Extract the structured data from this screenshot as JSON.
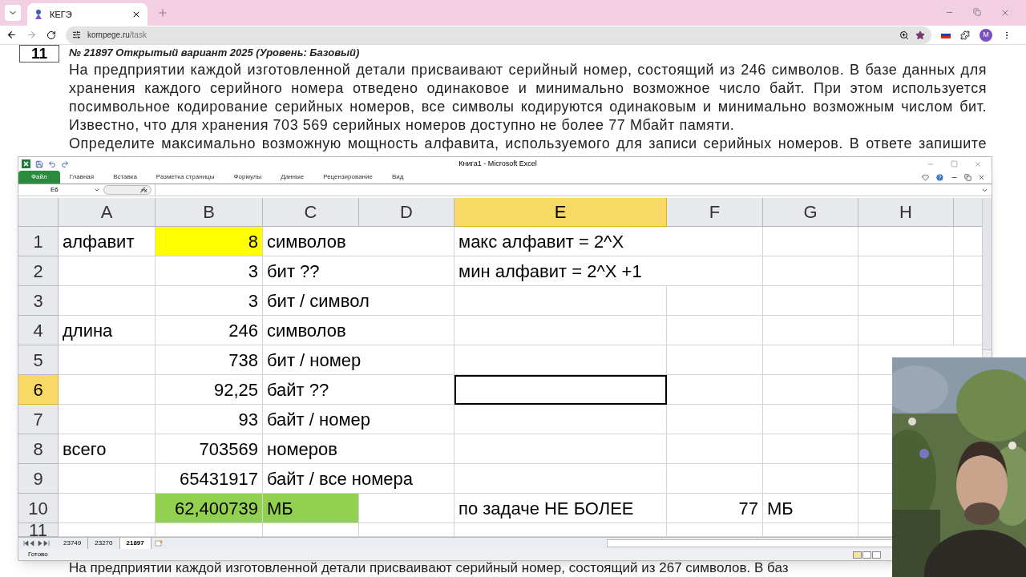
{
  "browser": {
    "tab_title": "КЕГЭ",
    "url_host": "kompege.ru",
    "url_path": "/task",
    "avatar": "M"
  },
  "task": {
    "number": "11",
    "title": "№ 21897 Открытый вариант 2025 (Уровень: Базовый)",
    "paragraphs": [
      "На предприятии каждой изготовленной детали присваивают серийный номер, состоящий из 246 символов. В базе данных для хранения каждого серийного номера отведено одинаковое и минимально возможное число байт. При этом используется посимвольное кодирование серийных номеров, все символы кодируются одинаковым и минимально возможным числом бит. Известно, что для хранения 703 569 серийных номеров доступно не более 77 Мбайт памяти.",
      "Определите максимально возможную мощность алфавита, используемого для записи серийных номеров. В ответе запишите"
    ],
    "next_text": "На предприятии каждой изготовленной детали присваивают серийный номер, состоящий из 267 символов. В баз"
  },
  "excel": {
    "title": "Книга1 - Microsoft Excel",
    "file_menu": "Файл",
    "ribbon_tabs": [
      "Главная",
      "Вставка",
      "Разметка страницы",
      "Формулы",
      "Данные",
      "Рецензирование",
      "Вид"
    ],
    "name_box": "E6",
    "columns": [
      {
        "label": "A",
        "selected": false
      },
      {
        "label": "B",
        "selected": false
      },
      {
        "label": "C",
        "selected": false
      },
      {
        "label": "D",
        "selected": false
      },
      {
        "label": "E",
        "selected": true
      },
      {
        "label": "F",
        "selected": false
      },
      {
        "label": "G",
        "selected": false
      },
      {
        "label": "H",
        "selected": false
      }
    ],
    "rows": [
      {
        "header": "1",
        "selected": false,
        "cells": [
          {
            "text": "алфавит",
            "kind": "text",
            "selected": false
          },
          {
            "text": "8",
            "kind": "number",
            "color": "#ffff00",
            "selected": false
          },
          {
            "text": "символов",
            "kind": "text",
            "selected": false
          },
          {
            "selected": false
          },
          {
            "text": "макс алфавит = 2^X",
            "kind": "text",
            "selected": false
          },
          {
            "selected": false
          },
          {
            "selected": false
          },
          {
            "selected": false
          }
        ]
      },
      {
        "header": "2",
        "selected": false,
        "cells": [
          {
            "selected": false
          },
          {
            "text": "3",
            "kind": "number",
            "selected": false
          },
          {
            "text": "бит ??",
            "kind": "text",
            "selected": false
          },
          {
            "selected": false
          },
          {
            "text": "мин алфавит = 2^X +1",
            "kind": "text",
            "selected": false
          },
          {
            "selected": false
          },
          {
            "selected": false
          },
          {
            "selected": false
          }
        ]
      },
      {
        "header": "3",
        "selected": false,
        "cells": [
          {
            "selected": false
          },
          {
            "text": "3",
            "kind": "number",
            "selected": false
          },
          {
            "text": "бит / символ",
            "kind": "text",
            "selected": false
          },
          {
            "selected": false
          },
          {
            "selected": false
          },
          {
            "selected": false
          },
          {
            "selected": false
          },
          {
            "selected": false
          }
        ]
      },
      {
        "header": "4",
        "selected": false,
        "cells": [
          {
            "text": "длина",
            "kind": "text",
            "selected": false
          },
          {
            "text": "246",
            "kind": "number",
            "selected": false
          },
          {
            "text": "символов",
            "kind": "text",
            "selected": false
          },
          {
            "selected": false
          },
          {
            "selected": false
          },
          {
            "selected": false
          },
          {
            "selected": false
          },
          {
            "selected": false
          }
        ]
      },
      {
        "header": "5",
        "selected": false,
        "cells": [
          {
            "selected": false
          },
          {
            "text": "738",
            "kind": "number",
            "selected": false
          },
          {
            "text": "бит / номер",
            "kind": "text",
            "selected": false
          },
          {
            "selected": false
          },
          {
            "selected": false
          },
          {
            "selected": false
          },
          {
            "selected": false
          },
          {
            "selected": false
          }
        ]
      },
      {
        "header": "6",
        "selected": true,
        "cells": [
          {
            "selected": false
          },
          {
            "text": "92,25",
            "kind": "number",
            "selected": false
          },
          {
            "text": "байт ??",
            "kind": "text",
            "selected": false
          },
          {
            "selected": false
          },
          {
            "selected": true
          },
          {
            "selected": false
          },
          {
            "selected": false
          },
          {
            "selected": false
          }
        ]
      },
      {
        "header": "7",
        "selected": false,
        "cells": [
          {
            "selected": false
          },
          {
            "text": "93",
            "kind": "number",
            "selected": false
          },
          {
            "text": "байт / номер",
            "kind": "text",
            "selected": false
          },
          {
            "selected": false
          },
          {
            "selected": false
          },
          {
            "selected": false
          },
          {
            "selected": false
          },
          {
            "selected": false
          }
        ]
      },
      {
        "header": "8",
        "selected": false,
        "cells": [
          {
            "text": "всего",
            "kind": "text",
            "selected": false
          },
          {
            "text": "703569",
            "kind": "number",
            "selected": false
          },
          {
            "text": "номеров",
            "kind": "text",
            "selected": false
          },
          {
            "selected": false
          },
          {
            "selected": false
          },
          {
            "selected": false
          },
          {
            "selected": false
          },
          {
            "selected": false
          }
        ]
      },
      {
        "header": "9",
        "selected": false,
        "cells": [
          {
            "selected": false
          },
          {
            "text": "65431917",
            "kind": "number",
            "selected": false
          },
          {
            "text": "байт / все номера",
            "kind": "text",
            "selected": false
          },
          {
            "selected": false
          },
          {
            "selected": false
          },
          {
            "selected": false
          },
          {
            "selected": false
          },
          {
            "selected": false
          }
        ]
      },
      {
        "header": "10",
        "selected": false,
        "cells": [
          {
            "selected": false
          },
          {
            "text": "62,400739",
            "kind": "number",
            "color": "#92d050",
            "selected": false
          },
          {
            "text": "МБ",
            "kind": "text",
            "color": "#92d050",
            "selected": false
          },
          {
            "selected": false
          },
          {
            "text": "по задаче НЕ БОЛЕЕ",
            "kind": "text",
            "selected": false
          },
          {
            "text": "77",
            "kind": "number",
            "selected": false
          },
          {
            "text": "МБ",
            "kind": "text",
            "selected": false
          },
          {
            "selected": false
          }
        ]
      },
      {
        "header": "11",
        "selected": false,
        "cells": [
          {
            "selected": false
          },
          {
            "selected": false
          },
          {
            "selected": false
          },
          {
            "selected": false
          },
          {
            "selected": false
          },
          {
            "selected": false
          },
          {
            "selected": false
          },
          {
            "selected": false
          }
        ]
      }
    ],
    "sheets": [
      {
        "label": "23749",
        "selected": false
      },
      {
        "label": "23270",
        "selected": false
      },
      {
        "label": "21897",
        "selected": true
      }
    ],
    "status": "Готово"
  }
}
